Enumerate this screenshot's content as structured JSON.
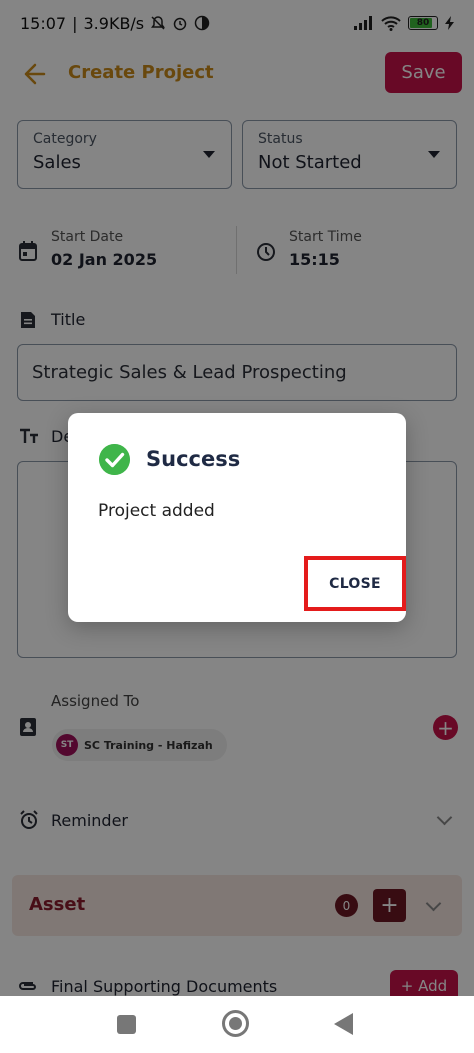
{
  "status_bar": {
    "time": "15:07",
    "network_speed": "3.9KB/s",
    "battery_level": "80",
    "icons": [
      "mute-icon",
      "alarm-icon",
      "data-saver-icon",
      "signal-icon",
      "wifi-icon",
      "battery-icon",
      "charging-icon"
    ]
  },
  "app_bar": {
    "title": "Create Project",
    "save_label": "Save"
  },
  "form": {
    "category": {
      "label": "Category",
      "value": "Sales"
    },
    "status": {
      "label": "Status",
      "value": "Not Started"
    },
    "start_date": {
      "label": "Start Date",
      "value": "02 Jan 2025"
    },
    "start_time": {
      "label": "Start Time",
      "value": "15:15"
    },
    "title": {
      "label": "Title",
      "value": "Strategic Sales & Lead Prospecting"
    },
    "description": {
      "label_visible": "De",
      "value": ""
    },
    "assigned_to": {
      "label": "Assigned To",
      "chips": [
        {
          "initials": "ST",
          "name": "SC Training - Hafizah"
        }
      ]
    },
    "reminder": {
      "label": "Reminder"
    },
    "asset": {
      "label": "Asset",
      "count": "0",
      "add_label": "+"
    },
    "final_docs": {
      "label": "Final Supporting Documents",
      "add_label": "+ Add"
    }
  },
  "dialog": {
    "title": "Success",
    "message": "Project added",
    "close_label": "CLOSE"
  },
  "colors": {
    "brand_gold": "#c98a1a",
    "accent_red": "#c8124a",
    "success_green": "#3fb54a",
    "highlight_red": "#e41b1b",
    "asset_dark": "#6b1723"
  }
}
